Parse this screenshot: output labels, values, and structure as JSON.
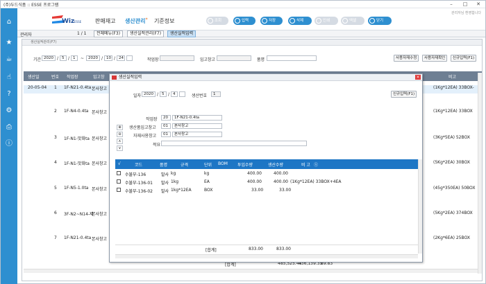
{
  "window": {
    "title": "(주)두드식품 :: ESSE 프로그램",
    "min": "–",
    "max": "□",
    "close": "✕"
  },
  "logo": {
    "text": "Wiz",
    "badge": "ESSE"
  },
  "menus": [
    "판매재고",
    "생산관리",
    "기준정보"
  ],
  "menu_dot": "*",
  "toolbar": {
    "search": "조회",
    "input": "입력",
    "save": "저장",
    "delete": "삭제",
    "print": "인쇄",
    "excel": "엑셀",
    "close": "닫기"
  },
  "user_text": "관리자님 환영합니다",
  "tabrow": {
    "crumb": "관리자",
    "page": "1 / 1",
    "tabs": [
      "전체메뉴(F3)",
      "생산실적관리(F7)",
      "생산실적입력"
    ]
  },
  "panel": {
    "title": "생산실적관리(F7)",
    "filter": {
      "period_label": "기간",
      "date_from": [
        "2020",
        "5",
        "1"
      ],
      "range_sep": "~",
      "date_to": [
        "2020",
        "10",
        "24"
      ],
      "workplace_label": "작업장",
      "warehouse_label": "입고창고",
      "item_label": "품명",
      "btn_material": "사용자재수정",
      "btn_material_confirm": "사용자재확인",
      "btn_new": "신규입력(F1)"
    },
    "grid_headers": [
      "생산일",
      "번호",
      "작업장",
      "입고창",
      "비고"
    ],
    "rows": [
      {
        "date": "20-05-04",
        "no": "1",
        "work": "1F-N21-0.4ta",
        "wh": "본사창고",
        "note": "(1Kg*12EA) 33BOX-"
      },
      {
        "date": "",
        "no": "2",
        "work": "1F-N4-0.4ta",
        "wh": "본사창고",
        "note": "(1Kg*12EA) 33BOX"
      },
      {
        "date": "",
        "no": "3",
        "work": "1F-N1-맛화ta",
        "wh": "본사창고",
        "note": "(3Kg*5EA) 52BOX"
      },
      {
        "date": "",
        "no": "4",
        "work": "1F-N1-맛화ta",
        "wh": "본사창고",
        "note": "(5Kg*2EA) 30BOX"
      },
      {
        "date": "",
        "no": "5",
        "work": "1F-N5-1.0ta",
        "wh": "본사창고",
        "note": "(45g*350EA) 50BOX"
      },
      {
        "date": "",
        "no": "6",
        "work": "3F-N2~N14-제",
        "wh": "본사창고",
        "note": "(5Kg*2EA) 374BOX"
      },
      {
        "date": "",
        "no": "7",
        "work": "1F-N21-0.4ta",
        "wh": "본사창고",
        "note": "(2Kg*6EA) 25BOX"
      }
    ],
    "totals": {
      "label": "[합계]",
      "v1": "485,525.40",
      "v2": "436,139.35",
      "v3": "89.83"
    }
  },
  "modal": {
    "title": "생산실적입력",
    "close": "×",
    "date_label": "일자",
    "date": [
      "2020",
      "5",
      "4"
    ],
    "prodno_label": "생산번호",
    "prodno": "1",
    "btn_new": "신규입력(F1)",
    "workplace_label": "작업장",
    "workplace_code": "20",
    "workplace_name": "1F-N21-0.4ta",
    "in_wh_label": "생산품입고창고",
    "in_wh_code": "01",
    "in_wh_name": "본사창고",
    "mat_wh_label": "자재사용창고",
    "mat_wh_code": "01",
    "mat_wh_name": "본사창고",
    "memo_label": "적요",
    "side_ctls": [
      "⊕",
      "⊖",
      "∧",
      "∨"
    ],
    "headers": [
      "√",
      "코드",
      "품명",
      "규격",
      "단위",
      "BOM",
      "투입수량",
      "생산수량",
      "비 고"
    ],
    "header_sort": "ⓢ",
    "rows": [
      {
        "code": "수불부-136",
        "name": "발사",
        "spec": "kg",
        "unit": "kg",
        "in": "400.00",
        "out": "400.00",
        "note": ""
      },
      {
        "code": "수불부-136-01",
        "name": "발사",
        "spec": "1kg",
        "unit": "EA",
        "in": "400.00",
        "out": "400.00",
        "note": "(1Kg*12EA) 33BOX+4EA"
      },
      {
        "code": "수불부-136-02",
        "name": "발사",
        "spec": "1kg*12EA",
        "unit": "BOX",
        "in": "33.00",
        "out": "33.00",
        "note": ""
      }
    ],
    "total_label": "[합계]",
    "total_in": "833.00",
    "total_out": "833.00"
  }
}
